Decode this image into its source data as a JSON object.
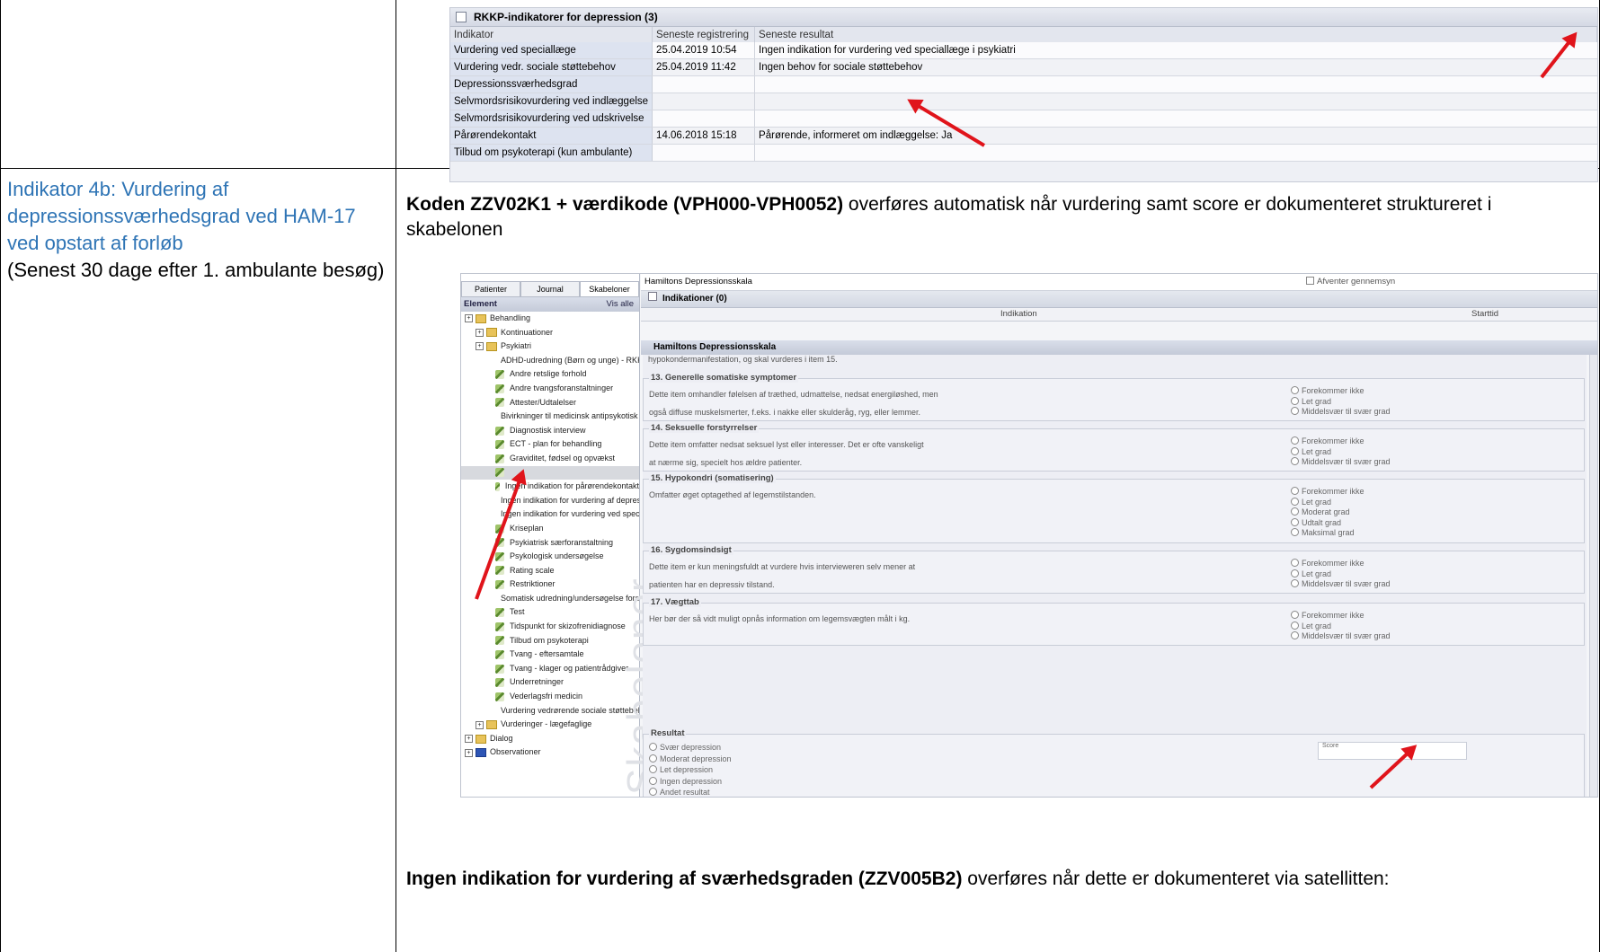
{
  "indicator": {
    "title": "Indikator 4b: Vurdering af depressionssværhedsgrad ved HAM-17 ved opstart af forløb",
    "note": "(Senest 30 dage efter 1. ambulante besøg)"
  },
  "paragraph1": {
    "bold": "Koden ZZV02K1 + værdikode (VPH000-VPH0052)",
    "rest": " overføres automatisk når vurdering samt score er dokumenteret struktureret i skabelonen"
  },
  "paragraph2": {
    "bold": "Ingen indikation for vurdering af sværhedsgraden (ZZV005B2)",
    "rest": " overføres når dette er dokumenteret via satellitten:"
  },
  "rkkp": {
    "title": "RKKP-indikatorer for depression (3)",
    "columns": [
      "Indikator",
      "Seneste registrering",
      "Seneste resultat"
    ],
    "rows": [
      {
        "indikator": "Vurdering ved speciallæge",
        "reg": "25.04.2019 10:54",
        "res": "Ingen indikation for vurdering ved speciallæge i psykiatri"
      },
      {
        "indikator": "Vurdering vedr. sociale støttebehov",
        "reg": "25.04.2019 11:42",
        "res": "Ingen behov for sociale støttebehov"
      },
      {
        "indikator": "Depressionssværhedsgrad",
        "reg": "",
        "res": ""
      },
      {
        "indikator": "Selvmordsrisikovurdering ved indlæggelse",
        "reg": "",
        "res": ""
      },
      {
        "indikator": "Selvmordsrisikovurdering ved udskrivelse",
        "reg": "",
        "res": ""
      },
      {
        "indikator": "Pårørendekontakt",
        "reg": "14.06.2018 15:18",
        "res": "Pårørende, informeret om indlæggelse: Ja"
      },
      {
        "indikator": "Tilbud om psykoterapi (kun ambulante)",
        "reg": "",
        "res": ""
      }
    ]
  },
  "skabeloner": {
    "tabs": [
      "Patienter",
      "Journal",
      "Skabeloner"
    ],
    "header": "Element",
    "show_all": "Vis alle",
    "watermark": "Skabeloner",
    "items": [
      {
        "label": "Behandling",
        "type": "folder",
        "level": 0
      },
      {
        "label": "Kontinuationer",
        "type": "folder",
        "level": 1
      },
      {
        "label": "Psykiatri",
        "type": "folder",
        "level": 1
      },
      {
        "label": "ADHD-udredning (Børn og unge) - RKKP",
        "type": "leaf",
        "level": 2
      },
      {
        "label": "Andre retslige forhold",
        "type": "leaf",
        "level": 2
      },
      {
        "label": "Andre tvangsforanstaltninger",
        "type": "leaf",
        "level": 2
      },
      {
        "label": "Attester/Udtalelser",
        "type": "leaf",
        "level": 2
      },
      {
        "label": "Bivirkninger til medicinsk antipsykotisk be",
        "type": "leaf",
        "level": 2
      },
      {
        "label": "Diagnostisk interview",
        "type": "leaf",
        "level": 2
      },
      {
        "label": "ECT - plan for behandling",
        "type": "leaf",
        "level": 2
      },
      {
        "label": "Graviditet, fødsel og opvækst",
        "type": "leaf",
        "level": 2
      },
      {
        "label": "",
        "type": "leaf",
        "level": 2,
        "highlight": true
      },
      {
        "label": "Ingen indikation for pårørendekontakt",
        "type": "leaf",
        "level": 2
      },
      {
        "label": "Ingen indikation for vurdering af depressi",
        "type": "leaf",
        "level": 2
      },
      {
        "label": "Ingen indikation for vurdering ved special",
        "type": "leaf",
        "level": 2
      },
      {
        "label": "Kriseplan",
        "type": "leaf",
        "level": 2
      },
      {
        "label": "Psykiatrisk særforanstaltning",
        "type": "leaf",
        "level": 2
      },
      {
        "label": "Psykologisk undersøgelse",
        "type": "leaf",
        "level": 2
      },
      {
        "label": "Rating scale",
        "type": "leaf",
        "level": 2
      },
      {
        "label": "Restriktioner",
        "type": "leaf",
        "level": 2
      },
      {
        "label": "Somatisk udredning/undersøgelse foretag",
        "type": "leaf",
        "level": 2
      },
      {
        "label": "Test",
        "type": "leaf",
        "level": 2
      },
      {
        "label": "Tidspunkt for skizofrenidiagnose",
        "type": "leaf",
        "level": 2
      },
      {
        "label": "Tilbud om psykoterapi",
        "type": "leaf",
        "level": 2
      },
      {
        "label": "Tvang - eftersamtale",
        "type": "leaf",
        "level": 2
      },
      {
        "label": "Tvang - klager og patientrådgiver",
        "type": "leaf",
        "level": 2
      },
      {
        "label": "Underretninger",
        "type": "leaf",
        "level": 2
      },
      {
        "label": "Vederlagsfri medicin",
        "type": "leaf",
        "level": 2
      },
      {
        "label": "Vurdering vedrørende sociale støttebehov",
        "type": "leaf",
        "level": 2
      },
      {
        "label": "Vurderinger - lægefaglige",
        "type": "folder",
        "level": 1
      },
      {
        "label": "Dialog",
        "type": "folder",
        "level": 0
      },
      {
        "label": "Observationer",
        "type": "folder-blue",
        "level": 0
      }
    ]
  },
  "ham": {
    "top_label": "Hamiltons Depressionsskala",
    "await": "Afventer gennemsyn",
    "indikationer": "Indikationer (0)",
    "col_indikation": "Indikation",
    "col_starttid": "Starttid",
    "section_header": "Hamiltons Depressionsskala",
    "cut_text": "hypokondermanifestation, og skal vurderes i item 15.",
    "sections": [
      {
        "title": "13. Generelle somatiske symptomer",
        "text": [
          "Dette item omhandler følelsen af træthed, udmattelse, nedsat energiløshed, men",
          "også diffuse muskelsmerter, f.eks. i nakke eller skulderåg, ryg, eller lemmer."
        ],
        "options": [
          "Forekommer ikke",
          "Let grad",
          "Middelsvær til svær grad"
        ]
      },
      {
        "title": "14. Seksuelle forstyrrelser",
        "text": [
          "Dette item omfatter nedsat seksuel lyst eller interesser. Det er ofte vanskeligt",
          "at nærme sig, specielt hos ældre patienter."
        ],
        "options": [
          "Forekommer ikke",
          "Let grad",
          "Middelsvær til svær grad"
        ]
      },
      {
        "title": "15. Hypokondri (somatisering)",
        "text": [
          "Omfatter øget optagethed af legemstilstanden."
        ],
        "options": [
          "Forekommer ikke",
          "Let grad",
          "Moderat grad",
          "Udtalt grad",
          "Maksimal grad"
        ]
      },
      {
        "title": "16. Sygdomsindsigt",
        "text": [
          "Dette item er kun meningsfuldt at vurdere hvis intervieweren selv mener at",
          "patienten har en depressiv tilstand."
        ],
        "options": [
          "Forekommer ikke",
          "Let grad",
          "Middelsvær til svær grad"
        ]
      },
      {
        "title": "17. Vægttab",
        "text": [
          "Her bør der så vidt muligt opnås information om legemsvægten målt i kg."
        ],
        "options": [
          "Forekommer ikke",
          "Let grad",
          "Middelsvær til svær grad"
        ]
      }
    ],
    "result": {
      "title": "Resultat",
      "options": [
        "Svær depression",
        "Moderat depression",
        "Let depression",
        "Ingen depression",
        "Andet resultat"
      ],
      "score_label": "Score"
    }
  }
}
